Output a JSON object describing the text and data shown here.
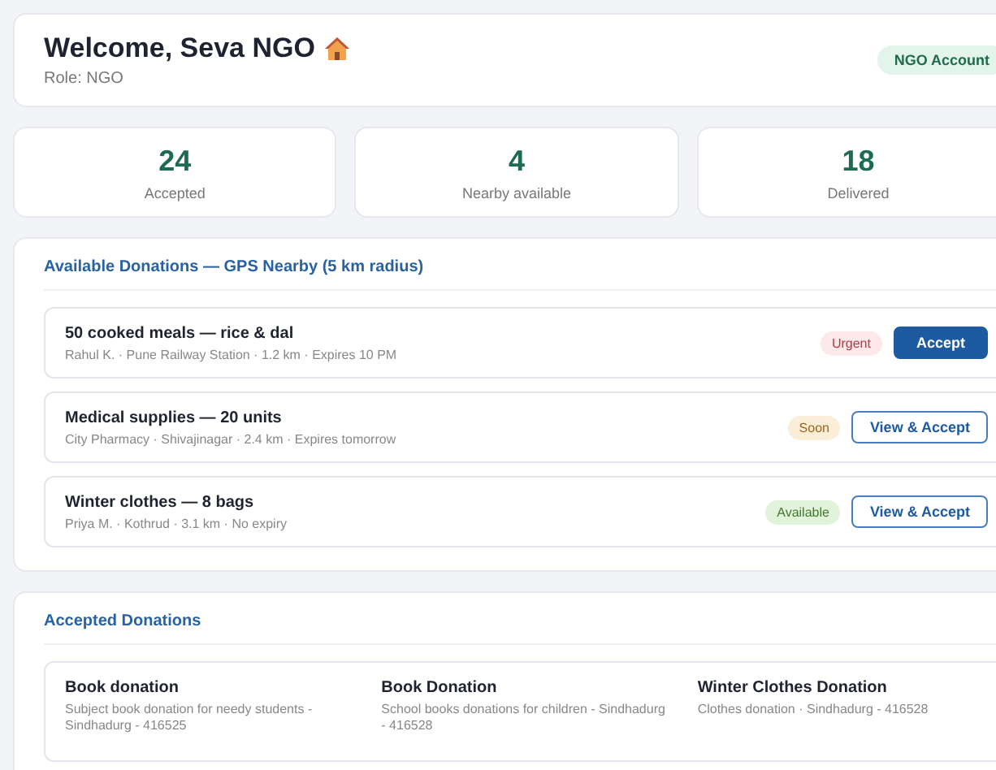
{
  "header": {
    "title": "Welcome, Seva NGO",
    "role": "Role: NGO",
    "account_badge": "NGO Account"
  },
  "stats": [
    {
      "value": "24",
      "label": "Accepted"
    },
    {
      "value": "4",
      "label": "Nearby available"
    },
    {
      "value": "18",
      "label": "Delivered"
    }
  ],
  "available": {
    "title": "Available Donations — GPS Nearby (5 km radius)",
    "items": [
      {
        "title": "50 cooked meals — rice & dal",
        "meta": "Rahul K. · Pune Railway Station · 1.2 km · Expires 10 PM",
        "badge": {
          "label": "Urgent",
          "kind": "urgent"
        },
        "button": {
          "label": "Accept",
          "kind": "primary"
        }
      },
      {
        "title": "Medical supplies — 20 units",
        "meta": "City Pharmacy · Shivajinagar · 2.4 km · Expires tomorrow",
        "badge": {
          "label": "Soon",
          "kind": "soon"
        },
        "button": {
          "label": "View & Accept",
          "kind": "outline"
        }
      },
      {
        "title": "Winter clothes — 8 bags",
        "meta": "Priya M. · Kothrud · 3.1 km · No expiry",
        "badge": {
          "label": "Available",
          "kind": "available"
        },
        "button": {
          "label": "View & Accept",
          "kind": "outline"
        }
      }
    ]
  },
  "accepted": {
    "title": "Accepted Donations",
    "items": [
      {
        "title": "Book donation",
        "description": "Subject book donation for needy students - Sindhadurg - 416525"
      },
      {
        "title": "Book Donation",
        "description": "School books donations for children - Sindhadurg - 416528"
      },
      {
        "title": "Winter Clothes Donation",
        "description": "Clothes donation · Sindhadurg - 416528"
      }
    ]
  }
}
